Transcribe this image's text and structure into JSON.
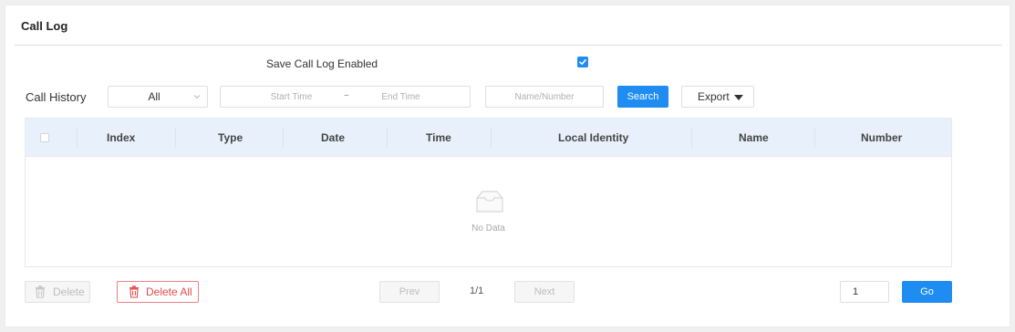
{
  "panel": {
    "title": "Call Log"
  },
  "settings": {
    "save_call_log_label": "Save Call Log Enabled",
    "save_call_log_enabled": true
  },
  "filters": {
    "call_history_label": "Call History",
    "type_select_value": "All",
    "start_time_placeholder": "Start Time",
    "range_separator": "~",
    "end_time_placeholder": "End Time",
    "name_number_placeholder": "Name/Number",
    "search_label": "Search",
    "export_label": "Export"
  },
  "table": {
    "columns": [
      "Index",
      "Type",
      "Date",
      "Time",
      "Local Identity",
      "Name",
      "Number"
    ],
    "rows": [],
    "empty_text": "No Data"
  },
  "footer": {
    "delete_label": "Delete",
    "delete_all_label": "Delete All",
    "prev_label": "Prev",
    "page_info": "1/1",
    "next_label": "Next",
    "page_input_value": "1",
    "go_label": "Go"
  },
  "colors": {
    "accent": "#1e8cf0",
    "danger": "#e64a4a",
    "table_header_bg": "#e8f1fb"
  },
  "icons": {
    "checkbox": "checkbox-checked-icon",
    "select_chevron": "chevron-down-icon",
    "export_caret": "caret-down-icon",
    "empty": "empty-inbox-icon",
    "trash": "trash-icon"
  }
}
